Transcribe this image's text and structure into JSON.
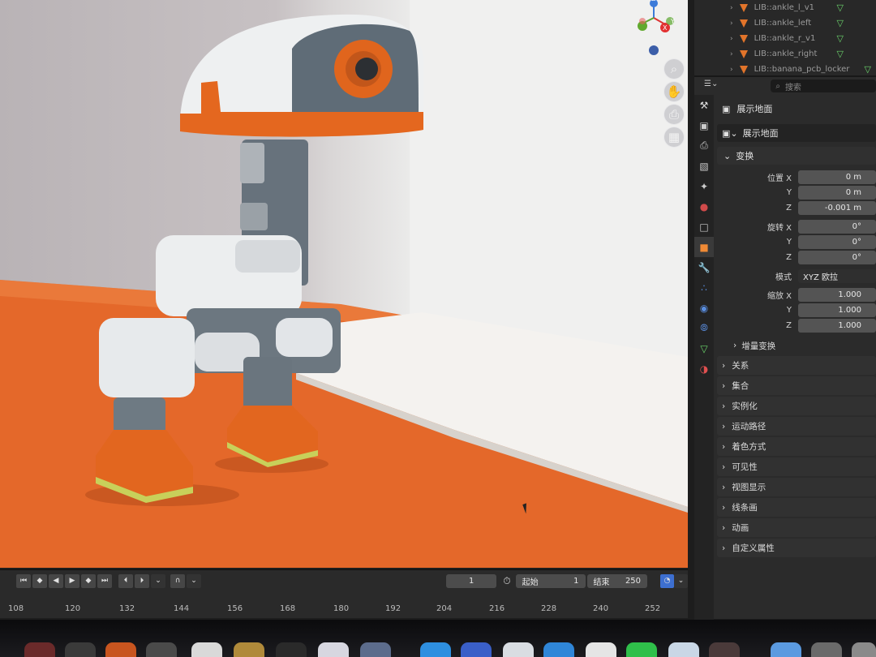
{
  "outliner": {
    "items": [
      {
        "label": "LIB::ankle_l_v1"
      },
      {
        "label": "LIB::ankle_left"
      },
      {
        "label": "LIB::ankle_r_v1"
      },
      {
        "label": "LIB::ankle_right"
      },
      {
        "label": "LIB::banana_pcb_locker"
      }
    ]
  },
  "properties": {
    "search_placeholder": "搜索",
    "object_context": "展示地面",
    "object_name": "展示地面",
    "transform": {
      "header": "变换",
      "location_label": "位置 X",
      "y_label": "Y",
      "z_label": "Z",
      "location": [
        "0 m",
        "0 m",
        "-0.001 m"
      ],
      "rotation_label": "旋转 X",
      "rotation": [
        "0°",
        "0°",
        "0°"
      ],
      "mode_label": "模式",
      "mode_value": "XYZ 欧拉",
      "scale_label": "缩放 X",
      "scale": [
        "1.000",
        "1.000",
        "1.000"
      ],
      "delta_label": "增量变换"
    },
    "panels": [
      "关系",
      "集合",
      "实例化",
      "运动路径",
      "着色方式",
      "可见性",
      "视图显示",
      "线条画",
      "动画",
      "自定义属性"
    ]
  },
  "timeline": {
    "current_frame": "1",
    "start_label": "起始",
    "start_value": "1",
    "end_label": "结束",
    "end_value": "250",
    "ticks": [
      "108",
      "120",
      "132",
      "144",
      "156",
      "168",
      "180",
      "192",
      "204",
      "216",
      "228",
      "240",
      "252"
    ]
  },
  "gizmo": {
    "z_label": "Z",
    "y_label": "Y",
    "x_label": "X"
  },
  "colors": {
    "orange": "#e36b1e",
    "mesh_green": "#69d369",
    "active_tab": "#f08a35"
  }
}
